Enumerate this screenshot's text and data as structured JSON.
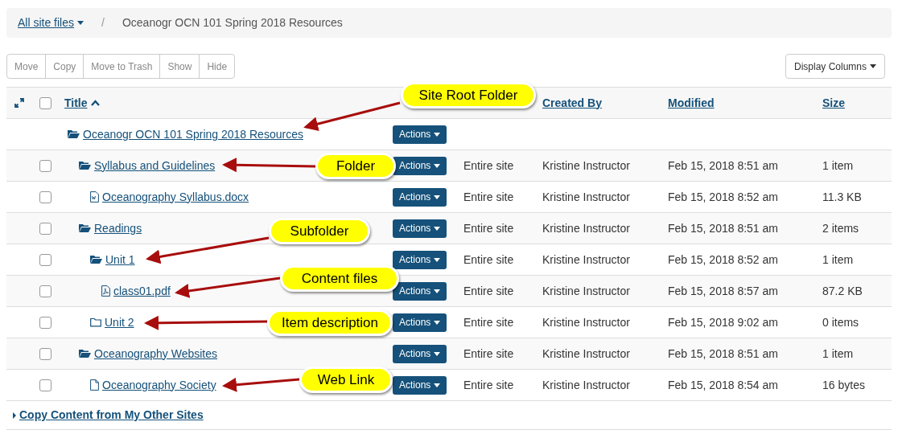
{
  "breadcrumb": {
    "root": "All site files",
    "separator": "/",
    "current": "Oceanogr OCN 101 Spring 2018 Resources"
  },
  "toolbar": {
    "buttons": [
      "Move",
      "Copy",
      "Move to Trash",
      "Show",
      "Hide"
    ],
    "display_columns": "Display Columns"
  },
  "table": {
    "columns": [
      {
        "label": "Title",
        "sorted": true
      },
      {
        "label": "Created By",
        "sorted": false
      },
      {
        "label": "Modified",
        "sorted": false
      },
      {
        "label": "Size",
        "sorted": false
      }
    ],
    "header_checkbox": {
      "checked": false
    },
    "rows": [
      {
        "title": "Oceanogr OCN 101 Spring 2018 Resources",
        "kind": "root",
        "actions": "Actions",
        "children": [
          {
            "title": "Syllabus and Guidelines",
            "kind": "folder",
            "checked": false,
            "access": "Entire site",
            "created_by": "Kristine Instructor",
            "modified": "Feb 15, 2018 8:51 am",
            "size": "1 item",
            "actions": "Actions",
            "children": [
              {
                "title": "Oceanography Syllabus.docx",
                "kind": "word",
                "checked": false,
                "access": "Entire site",
                "created_by": "Kristine Instructor",
                "modified": "Feb 15, 2018 8:52 am",
                "size": "11.3 KB",
                "actions": "Actions"
              }
            ]
          },
          {
            "title": "Readings",
            "kind": "folder",
            "checked": false,
            "access": "Entire site",
            "created_by": "Kristine Instructor",
            "modified": "Feb 15, 2018 8:51 am",
            "size": "2 items",
            "actions": "Actions",
            "children": [
              {
                "title": "Unit 1",
                "kind": "folder",
                "checked": false,
                "access": "Entire site",
                "created_by": "Kristine Instructor",
                "modified": "Feb 15, 2018 8:52 am",
                "size": "1 item",
                "actions": "Actions",
                "children": [
                  {
                    "title": "class01.pdf",
                    "kind": "pdf",
                    "checked": false,
                    "access": "Entire site",
                    "created_by": "Kristine Instructor",
                    "modified": "Feb 15, 2018 8:57 am",
                    "size": "87.2 KB",
                    "actions": "Actions"
                  }
                ]
              },
              {
                "title": "Unit 2",
                "kind": "empty_folder",
                "checked": false,
                "access": "Entire site",
                "created_by": "Kristine Instructor",
                "modified": "Feb 15, 2018 9:02 am",
                "size": "0 items",
                "actions": "Actions"
              }
            ]
          },
          {
            "title": "Oceanography Websites",
            "kind": "folder",
            "checked": false,
            "access": "Entire site",
            "created_by": "Kristine Instructor",
            "modified": "Feb 15, 2018 8:51 am",
            "size": "1 item",
            "actions": "Actions",
            "children": [
              {
                "title": "Oceanography Society",
                "kind": "link",
                "checked": false,
                "access": "Entire site",
                "created_by": "Kristine Instructor",
                "modified": "Feb 15, 2018 8:54 am",
                "size": "16 bytes",
                "actions": "Actions"
              }
            ]
          }
        ]
      }
    ]
  },
  "copy_content_link": "Copy Content from My Other Sites",
  "callouts": [
    {
      "text": "Site Root Folder"
    },
    {
      "text": "Folder"
    },
    {
      "text": "Subfolder"
    },
    {
      "text": "Content files"
    },
    {
      "text": "Item description"
    },
    {
      "text": "Web Link"
    }
  ]
}
